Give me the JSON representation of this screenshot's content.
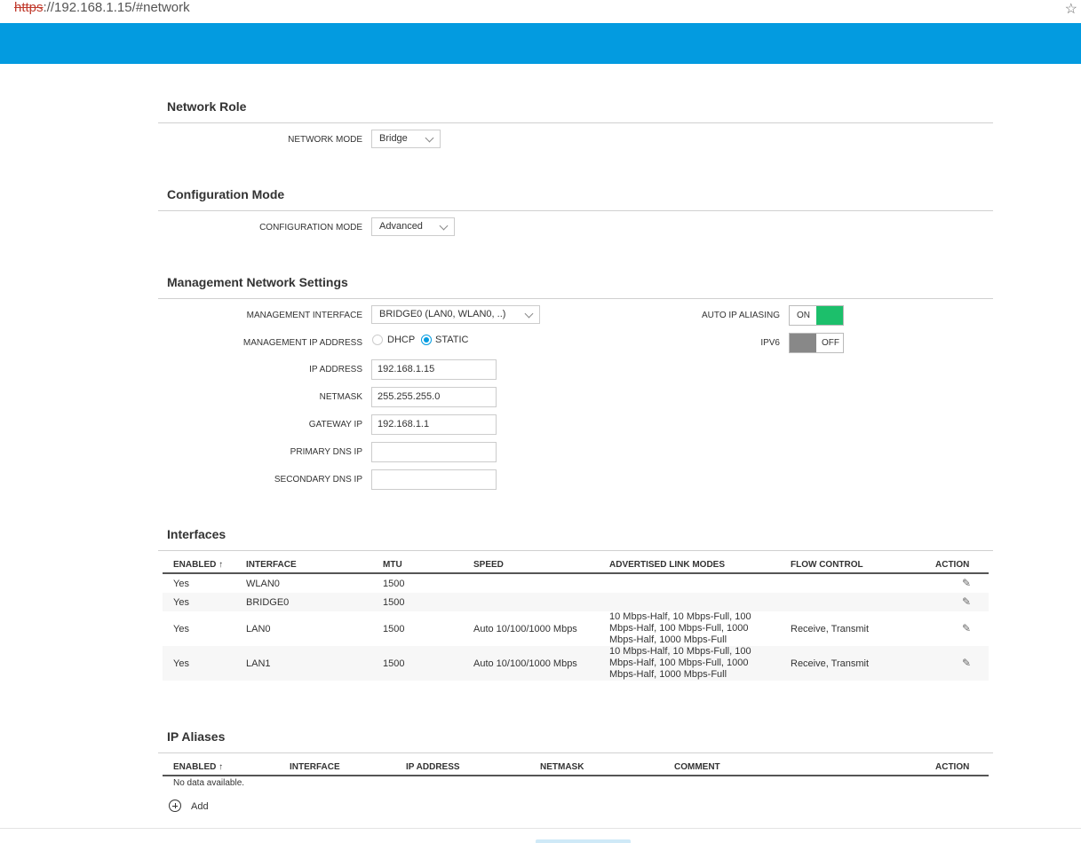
{
  "browser": {
    "url_protocol": "https",
    "url_rest": "://192.168.1.15/#network"
  },
  "sections": {
    "network_role": "Network Role",
    "configuration_mode": "Configuration Mode",
    "management": "Management Network Settings",
    "interfaces": "Interfaces",
    "ip_aliases": "IP Aliases"
  },
  "network_mode": {
    "label": "NETWORK MODE",
    "value": "Bridge"
  },
  "config_mode": {
    "label": "CONFIGURATION MODE",
    "value": "Advanced"
  },
  "management": {
    "interface_label": "MANAGEMENT INTERFACE",
    "interface_value": "BRIDGE0 (LAN0, WLAN0, ..)",
    "ip_address_mode_label": "MANAGEMENT IP ADDRESS",
    "dhcp_label": "DHCP",
    "static_label": "STATIC",
    "ip_label": "IP ADDRESS",
    "ip_value": "192.168.1.15",
    "netmask_label": "NETMASK",
    "netmask_value": "255.255.255.0",
    "gateway_label": "GATEWAY IP",
    "gateway_value": "192.168.1.1",
    "primary_dns_label": "PRIMARY DNS IP",
    "primary_dns_value": "",
    "secondary_dns_label": "SECONDARY DNS IP",
    "secondary_dns_value": "",
    "auto_alias_label": "AUTO IP ALIASING",
    "auto_alias_state": "ON",
    "ipv6_label": "IPV6",
    "ipv6_state": "OFF"
  },
  "interfaces_table": {
    "headers": [
      "ENABLED",
      "INTERFACE",
      "MTU",
      "SPEED",
      "ADVERTISED LINK MODES",
      "FLOW CONTROL",
      "ACTION"
    ],
    "rows": [
      {
        "enabled": "Yes",
        "interface": "WLAN0",
        "mtu": "1500",
        "speed": "",
        "modes1": "",
        "modes2": "",
        "modes3": "",
        "flow": ""
      },
      {
        "enabled": "Yes",
        "interface": "BRIDGE0",
        "mtu": "1500",
        "speed": "",
        "modes1": "",
        "modes2": "",
        "modes3": "",
        "flow": ""
      },
      {
        "enabled": "Yes",
        "interface": "LAN0",
        "mtu": "1500",
        "speed": "Auto 10/100/1000 Mbps",
        "modes1": "10 Mbps-Half, 10 Mbps-Full, 100",
        "modes2": "Mbps-Half, 100 Mbps-Full, 1000",
        "modes3": "Mbps-Half, 1000 Mbps-Full",
        "flow": "Receive, Transmit"
      },
      {
        "enabled": "Yes",
        "interface": "LAN1",
        "mtu": "1500",
        "speed": "Auto 10/100/1000 Mbps",
        "modes1": "10 Mbps-Half, 10 Mbps-Full, 100",
        "modes2": "Mbps-Half, 100 Mbps-Full, 1000",
        "modes3": "Mbps-Half, 1000 Mbps-Full",
        "flow": "Receive, Transmit"
      }
    ]
  },
  "aliases_table": {
    "headers": [
      "ENABLED",
      "INTERFACE",
      "IP ADDRESS",
      "NETMASK",
      "COMMENT",
      "ACTION"
    ],
    "empty_text": "No data available.",
    "add_label": "Add"
  },
  "colors": {
    "accent": "#039be0",
    "toggle_on": "#1cbf6b",
    "toggle_off": "#888888"
  }
}
